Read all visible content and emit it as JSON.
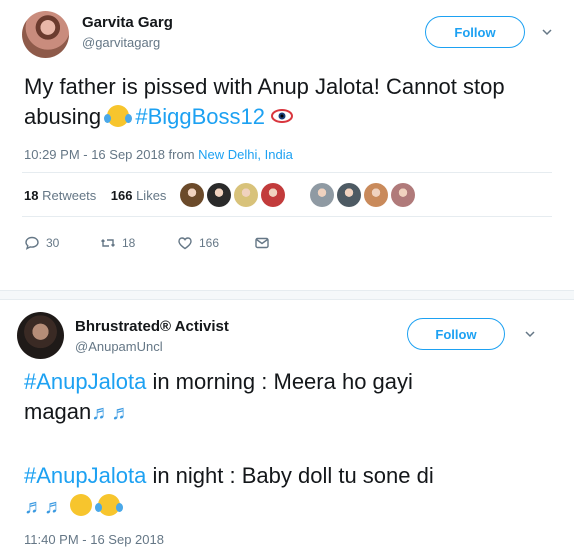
{
  "tweet1": {
    "display_name": "Garvita Garg",
    "handle": "@garvitagarg",
    "follow_label": "Follow",
    "text_plain": "My father is pissed with Anup Jalota! Cannot stop abusing",
    "hashtag": "#BiggBoss12",
    "timestamp": "10:29 PM - 16 Sep 2018 from ",
    "location": "New Delhi, India",
    "retweets_count": "18",
    "retweets_label": "Retweets",
    "likes_count": "166",
    "likes_label": "Likes",
    "reply_count": "30",
    "retweet_action_count": "18",
    "like_action_count": "166",
    "liker_colors": [
      "#6b4a2a",
      "#2a2a2a",
      "#d8c27a",
      "#c23b3b",
      "#8f9aa3",
      "#4d5a63",
      "#c98a5b",
      "#b07a7a"
    ]
  },
  "tweet2": {
    "display_name": "Bhrustrated® Activist",
    "handle": "@AnupamUncl",
    "follow_label": "Follow",
    "line1_hashtag": "#AnupJalota",
    "line1_text": " in morning : Meera ho gayi",
    "line2_text": "magan",
    "line3_hashtag": "#AnupJalota",
    "line3_text": " in night : Baby doll tu sone di",
    "timestamp": "11:40 PM - 16 Sep 2018"
  },
  "colors": {
    "accent": "#1da1f2",
    "secondary_text": "#657786",
    "primary_text": "#14171a"
  }
}
